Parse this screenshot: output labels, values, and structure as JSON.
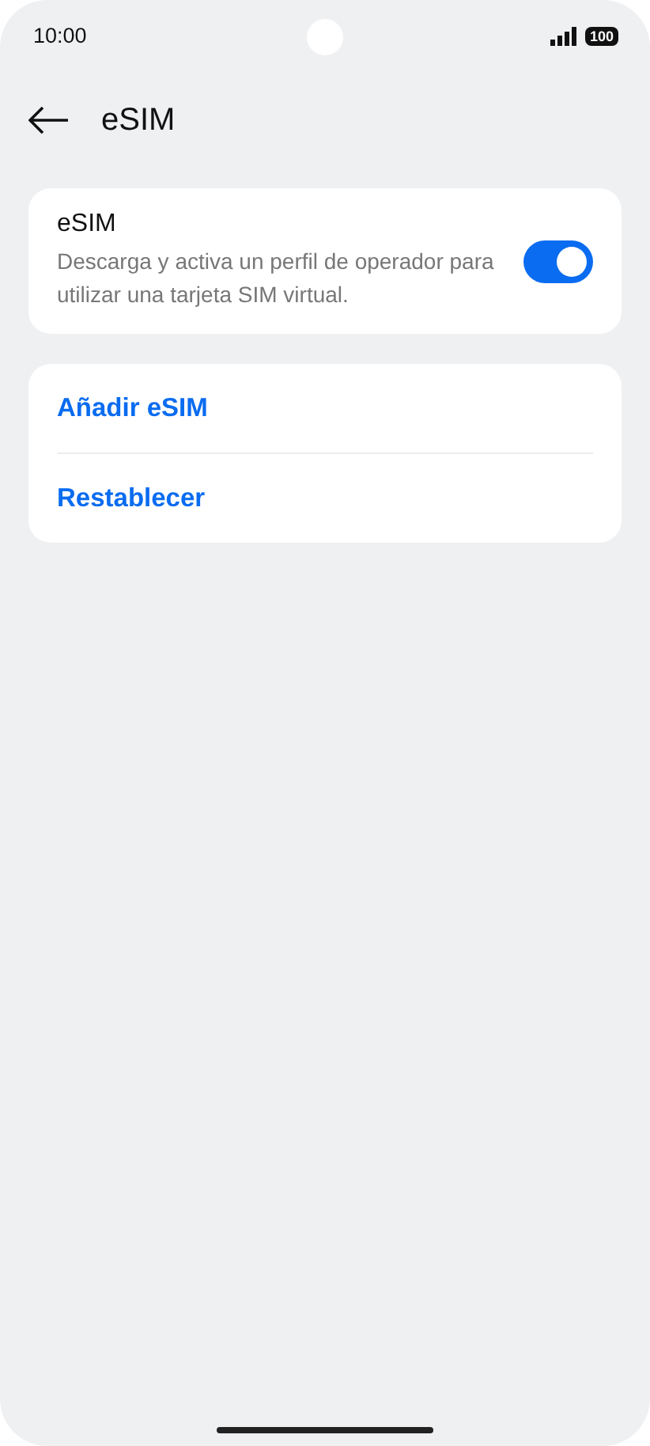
{
  "status_bar": {
    "time": "10:00",
    "battery": "100"
  },
  "header": {
    "title": "eSIM"
  },
  "esim_card": {
    "title": "eSIM",
    "description": "Descarga y activa un perfil de operador para utilizar una tarjeta SIM virtual.",
    "on": true
  },
  "actions": [
    {
      "label": "Añadir eSIM"
    },
    {
      "label": "Restablecer"
    }
  ]
}
